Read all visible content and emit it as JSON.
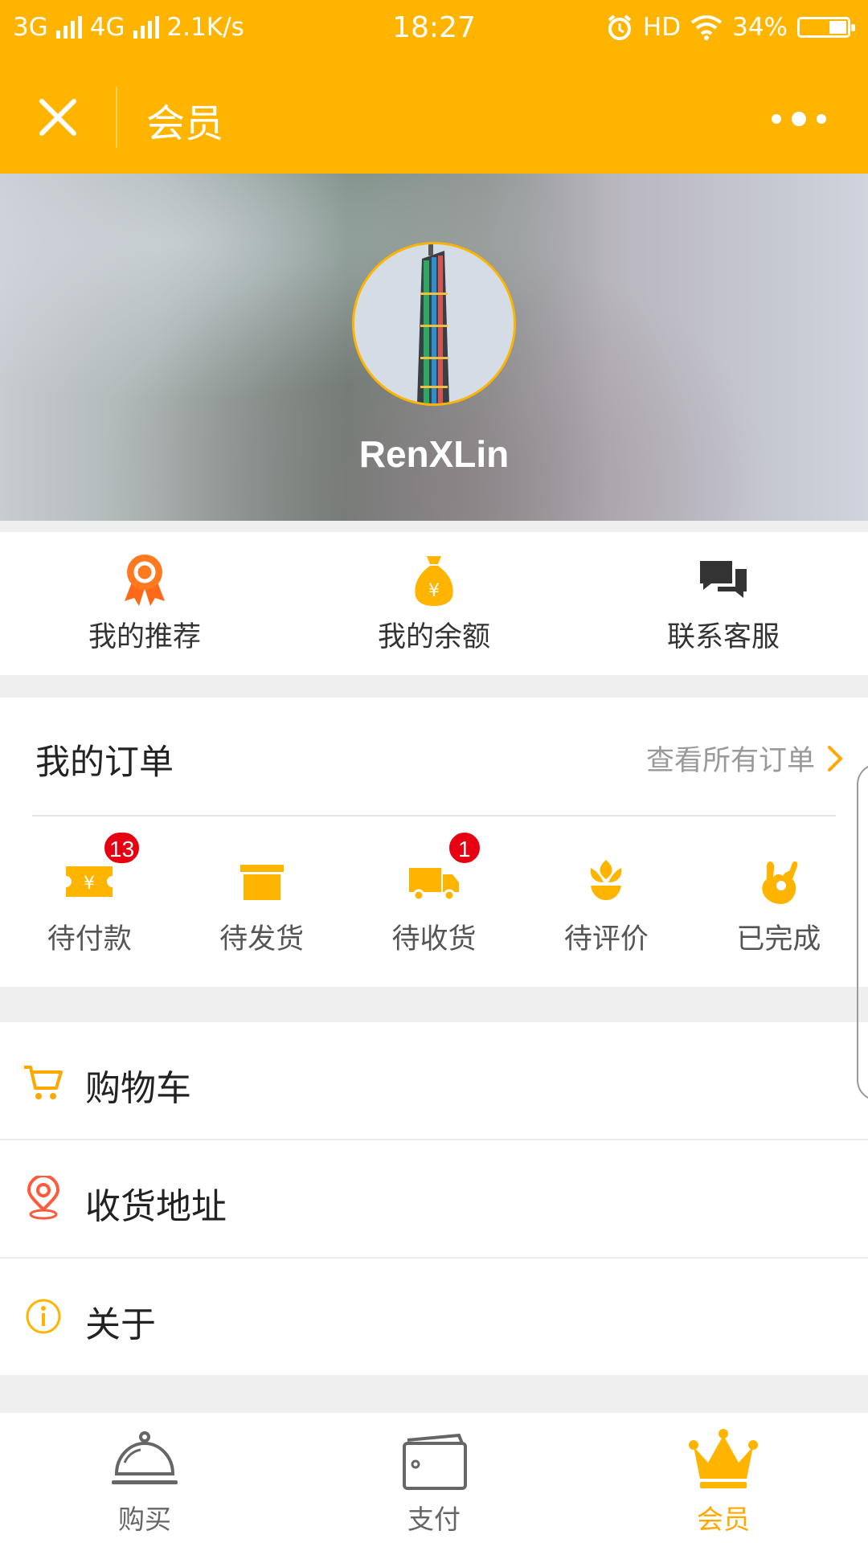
{
  "status_bar": {
    "network_1": "3G",
    "network_2": "4G",
    "speed": "2.1K/s",
    "time": "18:27",
    "hd": "HD",
    "battery": "34%",
    "battery_level": 0.34
  },
  "nav": {
    "title": "会员",
    "close_icon": "close-icon",
    "more_icon": "more-dots-icon"
  },
  "profile": {
    "username": "RenXLin"
  },
  "quick_actions": [
    {
      "label": "我的推荐",
      "icon": "ribbon-medal-icon"
    },
    {
      "label": "我的余额",
      "icon": "money-bag-icon"
    },
    {
      "label": "联系客服",
      "icon": "chat-bubbles-icon"
    }
  ],
  "orders": {
    "title": "我的订单",
    "view_all": "查看所有订单",
    "statuses": [
      {
        "label": "待付款",
        "icon": "ticket-yen-icon",
        "badge": "13"
      },
      {
        "label": "待发货",
        "icon": "box-icon",
        "badge": ""
      },
      {
        "label": "待收货",
        "icon": "truck-icon",
        "badge": "1"
      },
      {
        "label": "待评价",
        "icon": "flower-icon",
        "badge": ""
      },
      {
        "label": "已完成",
        "icon": "ok-hand-icon",
        "badge": ""
      }
    ]
  },
  "menu": [
    {
      "label": "购物车",
      "icon": "cart-icon"
    },
    {
      "label": "收货地址",
      "icon": "location-pin-icon"
    },
    {
      "label": "关于",
      "icon": "info-icon"
    }
  ],
  "tabs": [
    {
      "label": "购买",
      "icon": "cloche-icon",
      "active": false
    },
    {
      "label": "支付",
      "icon": "wallet-icon",
      "active": false
    },
    {
      "label": "会员",
      "icon": "crown-icon",
      "active": true
    }
  ],
  "colors": {
    "brand": "#ffb400",
    "accent_orange": "#ff8a00",
    "badge_red": "#e60012"
  }
}
